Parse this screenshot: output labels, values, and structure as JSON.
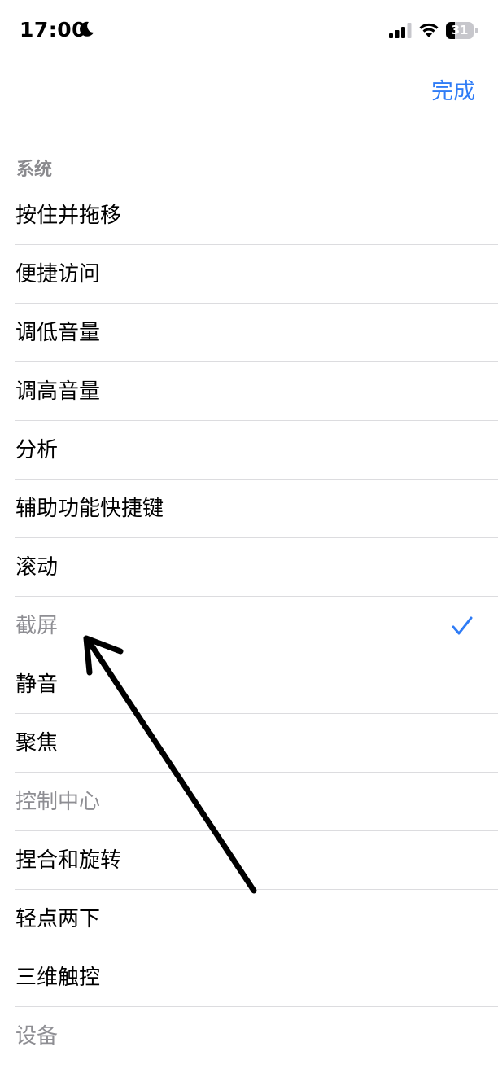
{
  "status_bar": {
    "time": "17:00",
    "battery_level": "31",
    "battery_fraction": 0.31,
    "icons": [
      "moon-icon",
      "signal-icon",
      "wifi-icon",
      "battery-icon"
    ]
  },
  "nav": {
    "done_label": "完成"
  },
  "section": {
    "header": "系统",
    "items": [
      {
        "label": "按住并拖移",
        "disabled": false,
        "selected": false
      },
      {
        "label": "便捷访问",
        "disabled": false,
        "selected": false
      },
      {
        "label": "调低音量",
        "disabled": false,
        "selected": false
      },
      {
        "label": "调高音量",
        "disabled": false,
        "selected": false
      },
      {
        "label": "分析",
        "disabled": false,
        "selected": false
      },
      {
        "label": "辅助功能快捷键",
        "disabled": false,
        "selected": false
      },
      {
        "label": "滚动",
        "disabled": false,
        "selected": false
      },
      {
        "label": "截屏",
        "disabled": true,
        "selected": true
      },
      {
        "label": "静音",
        "disabled": false,
        "selected": false
      },
      {
        "label": "聚焦",
        "disabled": false,
        "selected": false
      },
      {
        "label": "控制中心",
        "disabled": true,
        "selected": false
      },
      {
        "label": "捏合和旋转",
        "disabled": false,
        "selected": false
      },
      {
        "label": "轻点两下",
        "disabled": false,
        "selected": false
      },
      {
        "label": "三维触控",
        "disabled": false,
        "selected": false
      },
      {
        "label": "设备",
        "disabled": true,
        "selected": false
      }
    ]
  },
  "colors": {
    "accent": "#2f7cf6",
    "disabled_text": "#8e8e93",
    "separator": "#dcdcdf",
    "annotation_arrow": "#000000"
  }
}
